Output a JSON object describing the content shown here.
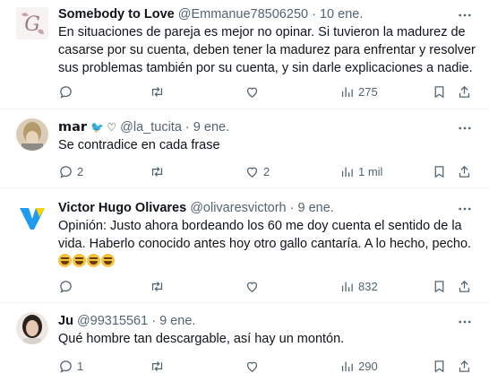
{
  "tweets": [
    {
      "name": "Somebody to Love",
      "handle": "@Emmanue78506250",
      "sep": "·",
      "time": "10 ene.",
      "text": "En situaciones de pareja es mejor no opinar. Si tuvieron la madurez de casarse por su cuenta, deben tener la madurez para enfrentar y resolver sus problemas también por su cuenta, y sin darle explicaciones a nadie.",
      "replies": "",
      "retweets": "",
      "likes": "",
      "views": "275"
    },
    {
      "name": "𝗺𝗮𝗿",
      "handle": "@la_tucita",
      "sep": "·",
      "time": "9 ene.",
      "text": "Se contradice en cada frase",
      "replies": "2",
      "retweets": "",
      "likes": "2",
      "views": "1 mil"
    },
    {
      "name": "Victor Hugo Olivares",
      "handle": "@olivaresvictorh",
      "sep": "·",
      "time": "9 ene.",
      "text": "Opinión: Justo ahora bordeando los 60 me doy cuenta el sentido de la vida. Haberlo conocido antes hoy otro gallo cantaría. A lo hecho, pecho.",
      "emoji_count": 4,
      "replies": "",
      "retweets": "",
      "likes": "",
      "views": "832"
    },
    {
      "name": "Ju",
      "handle": "@99315561",
      "sep": "·",
      "time": "9 ene.",
      "text": "Qué hombre tan descargable, así hay un montón.",
      "replies": "1",
      "retweets": "",
      "likes": "",
      "views": "290"
    }
  ],
  "icons": {
    "reply": "reply-icon",
    "retweet": "retweet-icon",
    "like": "heart-icon",
    "views": "views-icon",
    "bookmark": "bookmark-icon",
    "share": "share-icon",
    "more": "more-icon"
  },
  "colors": {
    "text": "#0f1419",
    "secondary": "#536471",
    "divider": "#eff3f4",
    "verified": "#1d9bf0"
  }
}
